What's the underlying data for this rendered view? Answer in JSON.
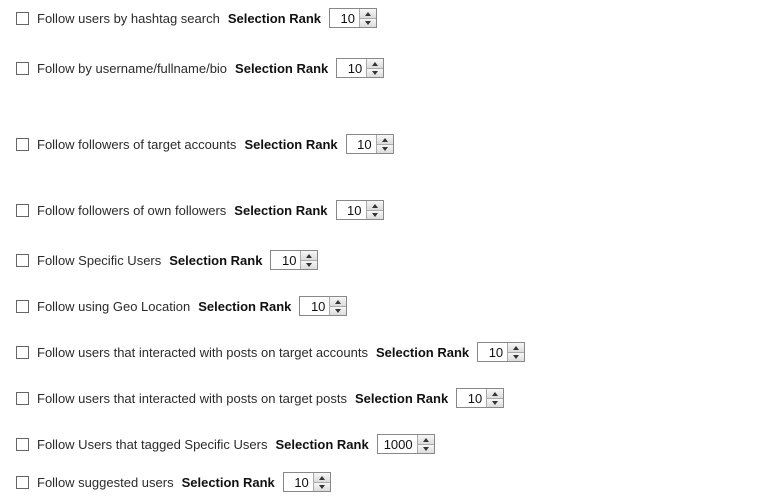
{
  "rank_label": "Selection Rank",
  "options": [
    {
      "id": "hashtag-search",
      "label": "Follow users by hashtag search",
      "value": 10,
      "gapBefore": 0
    },
    {
      "id": "username-bio",
      "label": "Follow by username/fullname/bio",
      "value": 10,
      "gapBefore": 30
    },
    {
      "id": "followers-target",
      "label": "Follow followers of target accounts",
      "value": 10,
      "gapBefore": 56
    },
    {
      "id": "followers-own",
      "label": "Follow followers of own followers",
      "value": 10,
      "gapBefore": 46
    },
    {
      "id": "specific-users",
      "label": "Follow Specific Users",
      "value": 10,
      "gapBefore": 30
    },
    {
      "id": "geo-location",
      "label": "Follow using Geo Location",
      "value": 10,
      "gapBefore": 26
    },
    {
      "id": "interacted-accounts",
      "label": "Follow users that interacted with posts on target accounts",
      "value": 10,
      "gapBefore": 26
    },
    {
      "id": "interacted-posts",
      "label": "Follow users that interacted with posts on target posts",
      "value": 10,
      "gapBefore": 26
    },
    {
      "id": "tagged-specific",
      "label": "Follow Users that tagged Specific Users",
      "value": 1000,
      "gapBefore": 26
    },
    {
      "id": "suggested-users",
      "label": "Follow suggested users",
      "value": 10,
      "gapBefore": 18
    }
  ]
}
